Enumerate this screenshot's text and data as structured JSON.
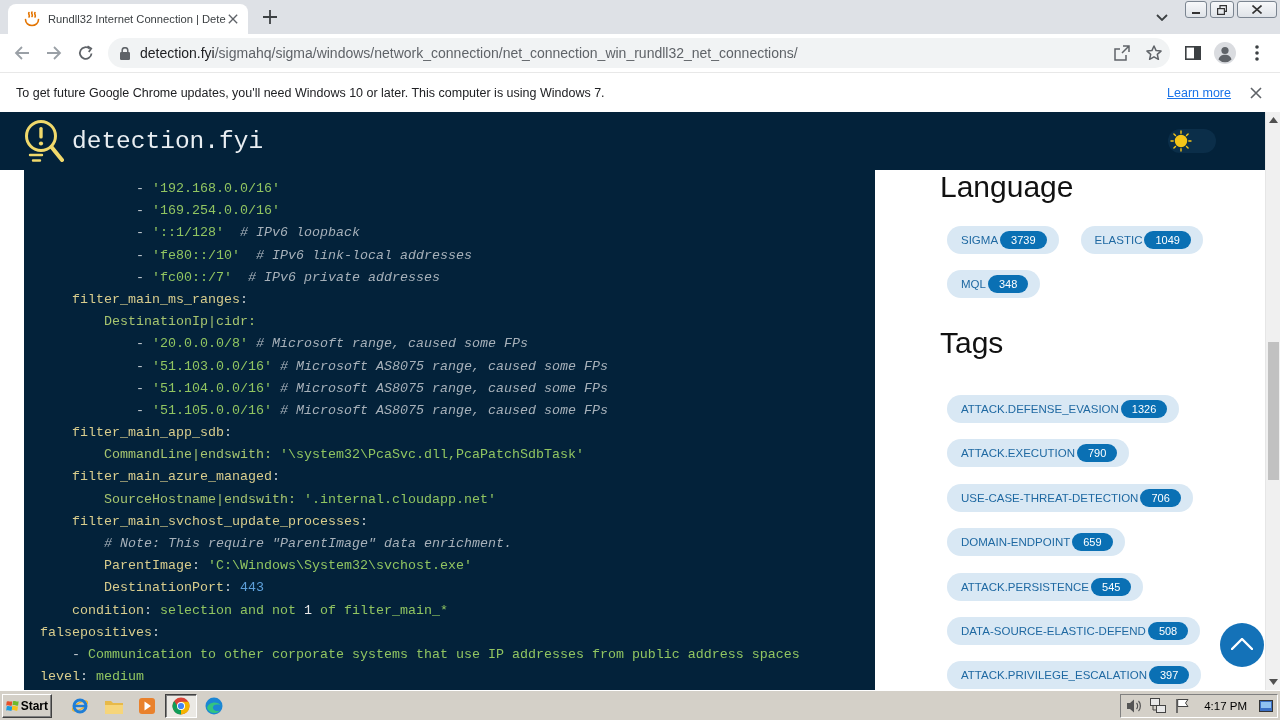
{
  "browser": {
    "tabs": [
      {
        "title": "Rundll32 Internet Connection | Dete",
        "selected": true
      }
    ],
    "address_bar": {
      "host": "detection.fyi",
      "path": "/sigmahq/sigma/windows/network_connection/net_connection_win_rundll32_net_connections/"
    },
    "info_bar": {
      "message": "To get future Google Chrome updates, you'll need Windows 10 or later. This computer is using Windows 7.",
      "link": "Learn more"
    }
  },
  "site_header": {
    "logo_text": "detection.fyi",
    "theme_toggle": {
      "on": false
    }
  },
  "code": {
    "lines": [
      {
        "children": [
          {
            "children": [
              {
                "children": [
                  {
                    "tokens": [
                      {
                        "kind": "punct",
                        "text": "- "
                      },
                      {
                        "kind": "string",
                        "text": "'192.168.0.0/16'"
                      }
                    ]
                  },
                  {
                    "tokens": [
                      {
                        "kind": "punct",
                        "text": "- "
                      },
                      {
                        "kind": "string",
                        "text": "'169.254.0.0/16'"
                      }
                    ]
                  },
                  {
                    "tokens": [
                      {
                        "kind": "punct",
                        "text": "- "
                      },
                      {
                        "kind": "string",
                        "text": "'::1/128'"
                      },
                      {
                        "kind": "comment",
                        "text": "  # IPv6 loopback"
                      }
                    ]
                  },
                  {
                    "tokens": [
                      {
                        "kind": "punct",
                        "text": "- "
                      },
                      {
                        "kind": "string",
                        "text": "'fe80::/10'"
                      },
                      {
                        "kind": "comment",
                        "text": "  # IPv6 link-local addresses"
                      }
                    ]
                  },
                  {
                    "tokens": [
                      {
                        "kind": "punct",
                        "text": "- "
                      },
                      {
                        "kind": "string",
                        "text": "'fc00::/7'"
                      },
                      {
                        "kind": "comment",
                        "text": "  # IPv6 private addresses"
                      }
                    ]
                  }
                ]
              }
            ]
          },
          {
            "tokens": [
              {
                "kind": "key",
                "text": "filter_main_ms_ranges"
              },
              {
                "kind": "punct",
                "text": ":"
              }
            ],
            "children": [
              {
                "tokens": [
                  {
                    "kind": "field",
                    "text": "DestinationIp|cidr:"
                  }
                ],
                "children": [
                  {
                    "tokens": [
                      {
                        "kind": "punct",
                        "text": "- "
                      },
                      {
                        "kind": "string",
                        "text": "'20.0.0.0/8'"
                      },
                      {
                        "kind": "comment",
                        "text": " # Microsoft range, caused some FPs"
                      }
                    ]
                  },
                  {
                    "tokens": [
                      {
                        "kind": "punct",
                        "text": "- "
                      },
                      {
                        "kind": "string",
                        "text": "'51.103.0.0/16'"
                      },
                      {
                        "kind": "comment",
                        "text": " # Microsoft AS8075 range, caused some FPs"
                      }
                    ]
                  },
                  {
                    "tokens": [
                      {
                        "kind": "punct",
                        "text": "- "
                      },
                      {
                        "kind": "string",
                        "text": "'51.104.0.0/16'"
                      },
                      {
                        "kind": "comment",
                        "text": " # Microsoft AS8075 range, caused some FPs"
                      }
                    ]
                  },
                  {
                    "tokens": [
                      {
                        "kind": "punct",
                        "text": "- "
                      },
                      {
                        "kind": "string",
                        "text": "'51.105.0.0/16'"
                      },
                      {
                        "kind": "comment",
                        "text": " # Microsoft AS8075 range, caused some FPs"
                      }
                    ]
                  }
                ]
              }
            ]
          },
          {
            "tokens": [
              {
                "kind": "key",
                "text": "filter_main_app_sdb"
              },
              {
                "kind": "punct",
                "text": ":"
              }
            ],
            "children": [
              {
                "tokens": [
                  {
                    "kind": "field",
                    "text": "CommandLine|endswith: "
                  },
                  {
                    "kind": "string",
                    "text": "'\\system32\\PcaSvc.dll,PcaPatchSdbTask'"
                  }
                ]
              }
            ]
          },
          {
            "tokens": [
              {
                "kind": "key",
                "text": "filter_main_azure_managed"
              },
              {
                "kind": "punct",
                "text": ":"
              }
            ],
            "children": [
              {
                "tokens": [
                  {
                    "kind": "field",
                    "text": "SourceHostname|endswith: "
                  },
                  {
                    "kind": "string",
                    "text": "'.internal.cloudapp.net'"
                  }
                ]
              }
            ]
          },
          {
            "tokens": [
              {
                "kind": "key",
                "text": "filter_main_svchost_update_processes"
              },
              {
                "kind": "punct",
                "text": ":"
              }
            ],
            "children": [
              {
                "tokens": [
                  {
                    "kind": "comment",
                    "text": "# Note: This require \"ParentImage\" data enrichment."
                  }
                ]
              },
              {
                "tokens": [
                  {
                    "kind": "key",
                    "text": "ParentImage"
                  },
                  {
                    "kind": "punct",
                    "text": ": "
                  },
                  {
                    "kind": "string",
                    "text": "'C:\\Windows\\System32\\svchost.exe'"
                  }
                ]
              },
              {
                "tokens": [
                  {
                    "kind": "key",
                    "text": "DestinationPort"
                  },
                  {
                    "kind": "punct",
                    "text": ": "
                  },
                  {
                    "kind": "number",
                    "text": "443"
                  }
                ]
              }
            ]
          },
          {
            "tokens": [
              {
                "kind": "key",
                "text": "condition"
              },
              {
                "kind": "punct",
                "text": ": "
              },
              {
                "kind": "value",
                "text": "selection and not "
              },
              {
                "kind": "text",
                "text": "1"
              },
              {
                "kind": "value",
                "text": " of filter_main_*"
              }
            ]
          }
        ]
      },
      {
        "tokens": [
          {
            "kind": "key",
            "text": "falsepositives"
          },
          {
            "kind": "punct",
            "text": ":"
          }
        ],
        "children": [
          {
            "tokens": [
              {
                "kind": "punct",
                "text": "- "
              },
              {
                "kind": "value",
                "text": "Communication to other corporate systems that use IP addresses from public address spaces"
              }
            ]
          }
        ]
      },
      {
        "tokens": [
          {
            "kind": "key",
            "text": "level"
          },
          {
            "kind": "punct",
            "text": ": "
          },
          {
            "kind": "value",
            "text": "medium"
          }
        ]
      }
    ]
  },
  "sidebar": {
    "sections": [
      {
        "heading": "Language",
        "kind": "wrap",
        "chips": [
          {
            "label": "SIGMA",
            "count": "3739"
          },
          {
            "label": "ELASTIC",
            "count": "1049"
          },
          {
            "label": "MQL",
            "count": "348"
          }
        ]
      },
      {
        "heading": "Tags",
        "kind": "column",
        "chips": [
          {
            "label": "ATTACK.DEFENSE_EVASION",
            "count": "1326"
          },
          {
            "label": "ATTACK.EXECUTION",
            "count": "790"
          },
          {
            "label": "USE-CASE-THREAT-DETECTION",
            "count": "706"
          },
          {
            "label": "DOMAIN-ENDPOINT",
            "count": "659"
          },
          {
            "label": "ATTACK.PERSISTENCE",
            "count": "545"
          },
          {
            "label": "DATA-SOURCE-ELASTIC-DEFEND",
            "count": "508"
          },
          {
            "label": "ATTACK.PRIVILEGE_ESCALATION",
            "count": "397"
          }
        ]
      }
    ]
  },
  "taskbar": {
    "start_label": "Start",
    "apps": [
      {
        "kind": "ie",
        "selected": false
      },
      {
        "kind": "folder",
        "selected": false
      },
      {
        "kind": "media",
        "selected": false
      },
      {
        "kind": "chrome",
        "selected": true
      },
      {
        "kind": "edge",
        "selected": false
      }
    ],
    "clock": "4:17 PM"
  }
}
